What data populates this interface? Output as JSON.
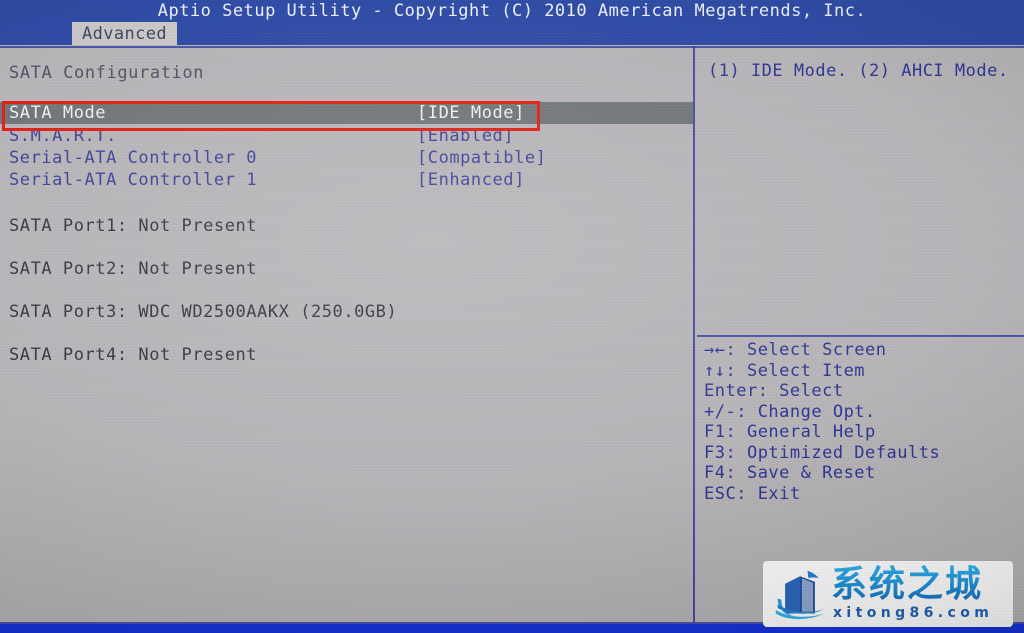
{
  "titlebar": {
    "title": "Aptio Setup Utility - Copyright (C) 2010 American Megatrends, Inc.",
    "tab_label": "Advanced"
  },
  "colors": {
    "titlebar_blue": "#2c49a4",
    "screen_background": "#b5b3b6",
    "menu_text_blue": "#3a3f96",
    "info_text": "#2f3640",
    "selection_background": "#6e7378",
    "selection_text": "#eceff2",
    "annotation_red": "#e01b10",
    "frame_blue": "#2f3aa0",
    "footer_blue": "#1531d8",
    "watermark_blue": "#1ba0e8"
  },
  "main": {
    "section_title": "SATA Configuration",
    "options": [
      {
        "label": "SATA Mode",
        "value": "[IDE Mode]",
        "selected": true
      },
      {
        "label": "S.M.A.R.T.",
        "value": "[Enabled]",
        "selected": false
      },
      {
        "label": "Serial-ATA Controller 0",
        "value": "[Compatible]",
        "selected": false
      },
      {
        "label": "Serial-ATA Controller 1",
        "value": "[Enhanced]",
        "selected": false
      }
    ],
    "ports": [
      "SATA Port1: Not Present",
      "SATA Port2: Not Present",
      "SATA Port3: WDC WD2500AAKX (250.0GB)",
      "SATA Port4: Not Present"
    ]
  },
  "help": {
    "text": "(1) IDE Mode. (2) AHCI Mode.",
    "keys": [
      {
        "icon": "→←",
        "text": ": Select Screen"
      },
      {
        "icon": "↑↓",
        "text": ": Select Item"
      },
      {
        "icon": "Enter",
        "text": ": Select"
      },
      {
        "icon": "+/-",
        "text": ": Change Opt."
      },
      {
        "icon": "F1",
        "text": ": General Help"
      },
      {
        "icon": "F3",
        "text": ": Optimized Defaults"
      },
      {
        "icon": "F4",
        "text": ": Save & Reset"
      },
      {
        "icon": "ESC",
        "text": ": Exit"
      }
    ]
  },
  "watermark": {
    "brand_cn": "系统之城",
    "brand_en": "xitong86.com"
  }
}
